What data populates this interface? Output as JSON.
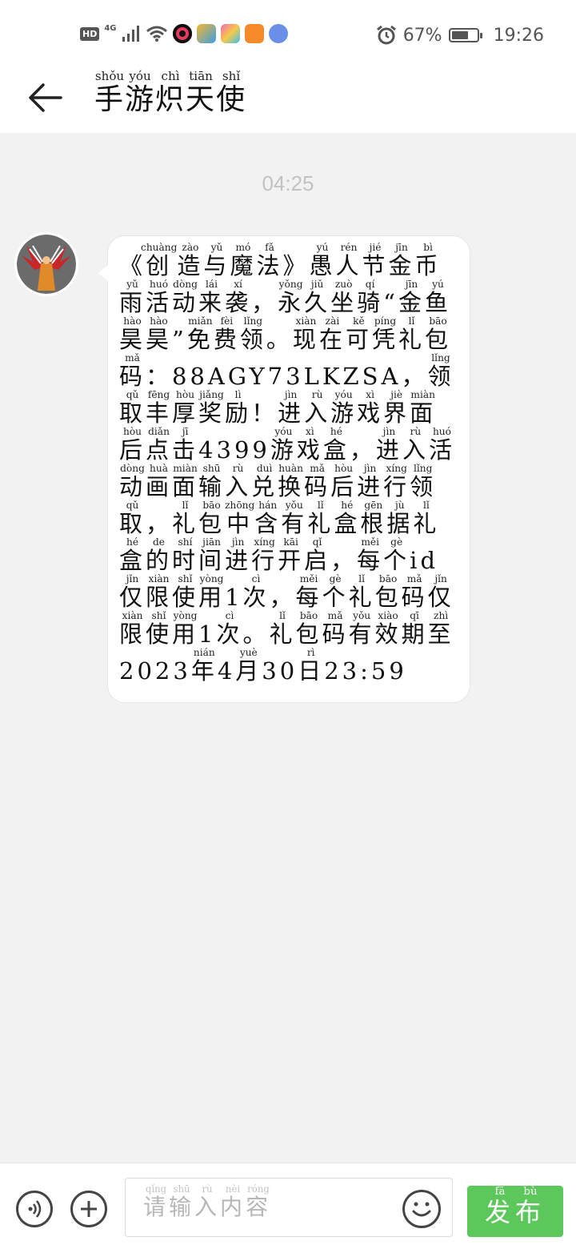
{
  "status_bar": {
    "hd": "HD",
    "network": "4G",
    "battery_percent": "67%",
    "battery_level": 0.67,
    "time": "19:26",
    "icons": [
      "signal-icon",
      "wifi-icon",
      "record-app-icon",
      "app-icon-1",
      "app-icon-2",
      "video-app-icon",
      "music-app-icon",
      "alarm-icon",
      "battery-icon"
    ]
  },
  "header": {
    "title": [
      {
        "c": "手",
        "p": "shǒu"
      },
      {
        "c": "游",
        "p": "yóu"
      },
      {
        "c": "炽",
        "p": "chì"
      },
      {
        "c": "天",
        "p": "tiān"
      },
      {
        "c": "使",
        "p": "shǐ"
      }
    ]
  },
  "chat": {
    "timestamp": "04:25",
    "message": [
      {
        "c": "《"
      },
      {
        "c": "创",
        "p": "chuàng"
      },
      {
        "c": "造",
        "p": "zào"
      },
      {
        "c": "与",
        "p": "yǔ"
      },
      {
        "c": "魔",
        "p": "mó"
      },
      {
        "c": "法",
        "p": "fǎ"
      },
      {
        "c": "》"
      },
      {
        "c": "愚",
        "p": "yú"
      },
      {
        "c": "人",
        "p": "rén"
      },
      {
        "c": "节",
        "p": "jié"
      },
      {
        "c": "金",
        "p": "jīn"
      },
      {
        "c": "币",
        "p": "bì"
      },
      {
        "c": "雨",
        "p": "yǔ"
      },
      {
        "c": "活",
        "p": "huó"
      },
      {
        "c": "动",
        "p": "dòng"
      },
      {
        "c": "来",
        "p": "lái"
      },
      {
        "c": "袭",
        "p": "xí"
      },
      {
        "c": "，"
      },
      {
        "c": "永",
        "p": "yǒng"
      },
      {
        "c": "久",
        "p": "jiǔ"
      },
      {
        "c": "坐",
        "p": "zuò"
      },
      {
        "c": "骑",
        "p": "qí"
      },
      {
        "c": "“"
      },
      {
        "c": "金",
        "p": "jīn"
      },
      {
        "c": "鱼",
        "p": "yú"
      },
      {
        "c": "昊",
        "p": "hào"
      },
      {
        "c": "昊",
        "p": "hào"
      },
      {
        "c": "”"
      },
      {
        "c": "免",
        "p": "miǎn"
      },
      {
        "c": "费",
        "p": "fèi"
      },
      {
        "c": "领",
        "p": "lǐng"
      },
      {
        "c": "。"
      },
      {
        "c": "现",
        "p": "xiàn"
      },
      {
        "c": "在",
        "p": "zài"
      },
      {
        "c": "可",
        "p": "kě"
      },
      {
        "c": "凭",
        "p": "píng"
      },
      {
        "c": "礼",
        "p": "lǐ"
      },
      {
        "c": "包",
        "p": "bāo"
      },
      {
        "c": "码",
        "p": "mǎ"
      },
      {
        "c": "："
      },
      {
        "c": "88AGY73LKZSA"
      },
      {
        "c": "，"
      },
      {
        "c": "领",
        "p": "lǐng"
      },
      {
        "c": "取",
        "p": "qǔ"
      },
      {
        "c": "丰",
        "p": "fēng"
      },
      {
        "c": "厚",
        "p": "hòu"
      },
      {
        "c": "奖",
        "p": "jiǎng"
      },
      {
        "c": "励",
        "p": "lì"
      },
      {
        "c": "！"
      },
      {
        "c": "进",
        "p": "jìn"
      },
      {
        "c": "入",
        "p": "rù"
      },
      {
        "c": "游",
        "p": "yóu"
      },
      {
        "c": "戏",
        "p": "xì"
      },
      {
        "c": "界",
        "p": "jiè"
      },
      {
        "c": "面",
        "p": "miàn"
      },
      {
        "c": "后",
        "p": "hòu"
      },
      {
        "c": "点",
        "p": "diǎn"
      },
      {
        "c": "击",
        "p": "jī"
      },
      {
        "c": "4399"
      },
      {
        "c": "游",
        "p": "yóu"
      },
      {
        "c": "戏",
        "p": "xì"
      },
      {
        "c": "盒",
        "p": "hé"
      },
      {
        "c": "，"
      },
      {
        "c": "进",
        "p": "jìn"
      },
      {
        "c": "入",
        "p": "rù"
      },
      {
        "c": "活",
        "p": "huó"
      },
      {
        "c": "动",
        "p": "dòng"
      },
      {
        "c": "画",
        "p": "huà"
      },
      {
        "c": "面",
        "p": "miàn"
      },
      {
        "c": "输",
        "p": "shū"
      },
      {
        "c": "入",
        "p": "rù"
      },
      {
        "c": "兑",
        "p": "duì"
      },
      {
        "c": "换",
        "p": "huàn"
      },
      {
        "c": "码",
        "p": "mǎ"
      },
      {
        "c": "后",
        "p": "hòu"
      },
      {
        "c": "进",
        "p": "jìn"
      },
      {
        "c": "行",
        "p": "xíng"
      },
      {
        "c": "领",
        "p": "lǐng"
      },
      {
        "c": "取",
        "p": "qǔ"
      },
      {
        "c": "，"
      },
      {
        "c": "礼",
        "p": "lǐ"
      },
      {
        "c": "包",
        "p": "bāo"
      },
      {
        "c": "中",
        "p": "zhōng"
      },
      {
        "c": "含",
        "p": "hán"
      },
      {
        "c": "有",
        "p": "yǒu"
      },
      {
        "c": "礼",
        "p": "lǐ"
      },
      {
        "c": "盒",
        "p": "hé"
      },
      {
        "c": "根",
        "p": "gēn"
      },
      {
        "c": "据",
        "p": "jù"
      },
      {
        "c": "礼",
        "p": "lǐ"
      },
      {
        "c": "盒",
        "p": "hé"
      },
      {
        "c": "的",
        "p": "de"
      },
      {
        "c": "时",
        "p": "shí"
      },
      {
        "c": "间",
        "p": "jiān"
      },
      {
        "c": "进",
        "p": "jìn"
      },
      {
        "c": "行",
        "p": "xíng"
      },
      {
        "c": "开",
        "p": "kāi"
      },
      {
        "c": "启",
        "p": "qǐ"
      },
      {
        "c": "，"
      },
      {
        "c": "每",
        "p": "měi"
      },
      {
        "c": "个",
        "p": "gè"
      },
      {
        "c": "id"
      },
      {
        "c": "仅",
        "p": "jǐn"
      },
      {
        "c": "限",
        "p": "xiàn"
      },
      {
        "c": "使",
        "p": "shǐ"
      },
      {
        "c": "用",
        "p": "yòng"
      },
      {
        "c": "1"
      },
      {
        "c": "次",
        "p": "cì"
      },
      {
        "c": "，"
      },
      {
        "c": "每",
        "p": "měi"
      },
      {
        "c": "个",
        "p": "gè"
      },
      {
        "c": "礼",
        "p": "lǐ"
      },
      {
        "c": "包",
        "p": "bāo"
      },
      {
        "c": "码",
        "p": "mǎ"
      },
      {
        "c": "仅",
        "p": "jǐn"
      },
      {
        "c": "限",
        "p": "xiàn"
      },
      {
        "c": "使",
        "p": "shǐ"
      },
      {
        "c": "用",
        "p": "yòng"
      },
      {
        "c": "1"
      },
      {
        "c": "次",
        "p": "cì"
      },
      {
        "c": "。"
      },
      {
        "c": "礼",
        "p": "lǐ"
      },
      {
        "c": "包",
        "p": "bāo"
      },
      {
        "c": "码",
        "p": "mǎ"
      },
      {
        "c": "有",
        "p": "yǒu"
      },
      {
        "c": "效",
        "p": "xiào"
      },
      {
        "c": "期",
        "p": "qī"
      },
      {
        "c": "至",
        "p": "zhì"
      },
      {
        "c": "2023"
      },
      {
        "c": "年",
        "p": "nián"
      },
      {
        "c": "4"
      },
      {
        "c": "月",
        "p": "yuè"
      },
      {
        "c": "30"
      },
      {
        "c": "日",
        "p": "rì"
      },
      {
        "c": "23:59"
      }
    ]
  },
  "input": {
    "placeholder": [
      {
        "c": "请",
        "p": "qǐng"
      },
      {
        "c": "输",
        "p": "shū"
      },
      {
        "c": "入",
        "p": "rù"
      },
      {
        "c": "内",
        "p": "nèi"
      },
      {
        "c": "容",
        "p": "róng"
      }
    ]
  },
  "send_button": {
    "label": [
      {
        "c": "发",
        "p": "fā"
      },
      {
        "c": "布",
        "p": "bù"
      }
    ],
    "color": "#5cc75a"
  }
}
